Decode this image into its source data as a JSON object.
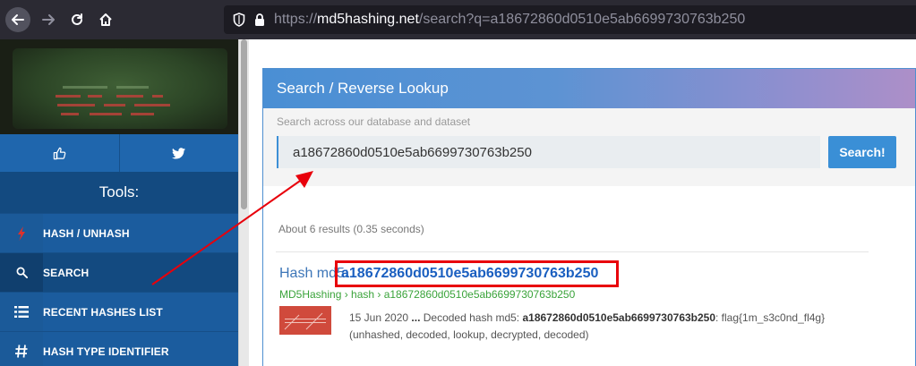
{
  "browser": {
    "url_prefix": "https://",
    "url_host": "md5hashing.net",
    "url_path": "/search?q=a18672860d0510e5ab6699730763b250"
  },
  "sidebar": {
    "tools_title": "Tools:",
    "items": [
      {
        "label": "HASH / UNHASH",
        "icon": "lightning-icon"
      },
      {
        "label": "SEARCH",
        "icon": "search-icon"
      },
      {
        "label": "RECENT HASHES LIST",
        "icon": "list-icon"
      },
      {
        "label": "HASH TYPE IDENTIFIER",
        "icon": "hash-icon"
      }
    ]
  },
  "panel": {
    "title": "Search / Reverse Lookup",
    "hint": "Search across our database and dataset",
    "query": "a18672860d0510e5ab6699730763b250",
    "button": "Search!"
  },
  "results": {
    "info": "About 6 results (0.35 seconds)",
    "items": [
      {
        "title_prefix": "Hash md5:",
        "hash": "a18672860d0510e5ab6699730763b250",
        "url": "MD5Hashing › hash › a18672860d0510e5ab6699730763b250",
        "date": "15 Jun 2020",
        "sep": " ... ",
        "desc_pre": "Decoded hash md5: ",
        "desc_hash": "a18672860d0510e5ab6699730763b250",
        "desc_post": ": flag{1m_s3c0nd_fl4g}",
        "tags": "(unhashed, decoded, lookup, decrypted, decoded)"
      }
    ]
  },
  "colors": {
    "annotation": "#e8000b",
    "sidebar": "#1b5c9e",
    "accent": "#3a8fd6"
  }
}
